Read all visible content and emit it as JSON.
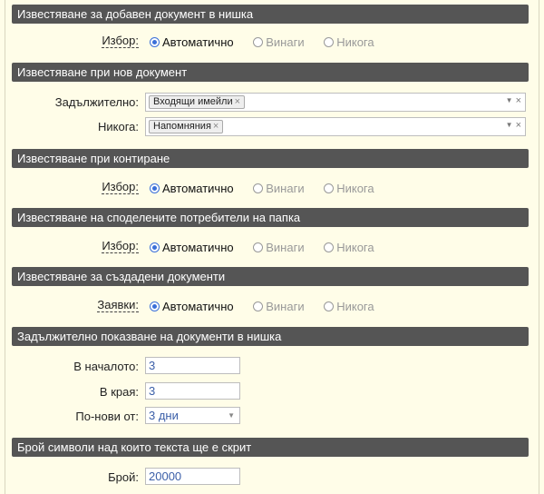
{
  "sections": [
    {
      "title": "Известяване за добавен документ в нишка"
    },
    {
      "title": "Известяване при нов документ"
    },
    {
      "title": "Известяване при контиране"
    },
    {
      "title": "Известяване на споделените потребители на папка"
    },
    {
      "title": "Известяване за създадени документи"
    },
    {
      "title": "Задължително показване на документи в нишка"
    },
    {
      "title": "Брой символи над които текста ще е скрит"
    }
  ],
  "choice_label": "Избор:",
  "requests_label": "Заявки:",
  "options": {
    "auto": "Автоматично",
    "always": "Винаги",
    "never": "Никога"
  },
  "new_doc": {
    "required_label": "Задължително:",
    "required_tag": "Входящи имейли",
    "never_label": "Никога:",
    "never_tag": "Напомняния",
    "tag_remove": "×",
    "clear": "×",
    "dropdown_arrow": "▼"
  },
  "thread_docs": {
    "start_label": "В началото:",
    "start_value": "3",
    "end_label": "В края:",
    "end_value": "3",
    "newer_label": "По-нови от:",
    "newer_value": "3 дни"
  },
  "chars": {
    "count_label": "Брой:",
    "count_value": "20000"
  },
  "colors": {
    "header_bg": "#555555",
    "page_bg": "#fffde8",
    "radio_accent": "#3a6fd8"
  }
}
